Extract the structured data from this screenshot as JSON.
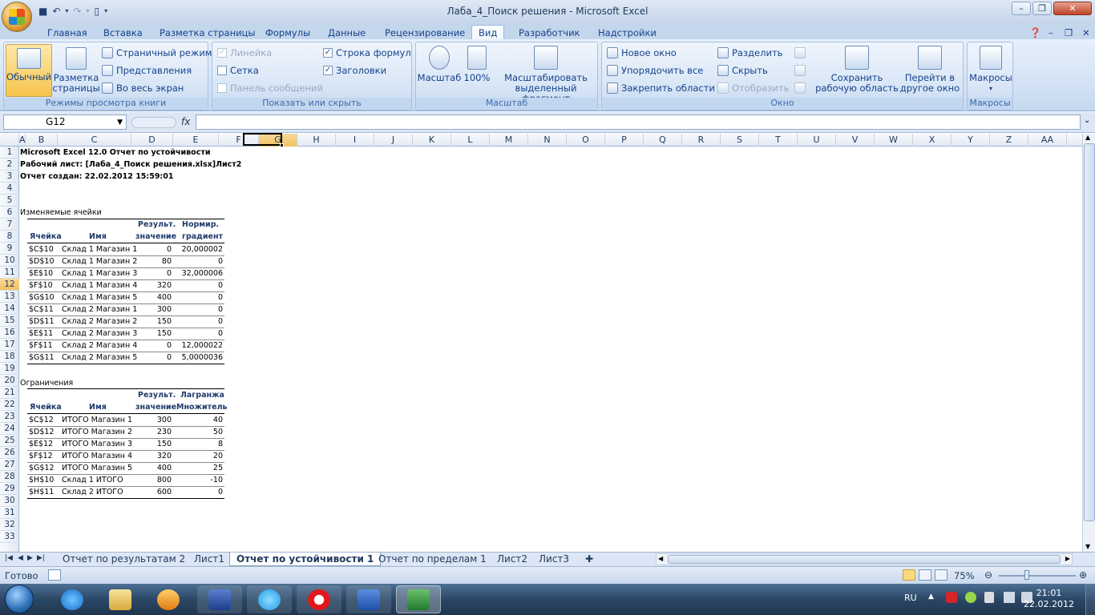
{
  "window": {
    "title": "Лаба_4_Поиск решения - Microsoft Excel"
  },
  "tabs": [
    "Главная",
    "Вставка",
    "Разметка страницы",
    "Формулы",
    "Данные",
    "Рецензирование",
    "Вид",
    "Разработчик",
    "Надстройки"
  ],
  "ribbon": {
    "normal": "Обычный",
    "page_layout": "Разметка страницы",
    "page_mode": "Страничный режим",
    "views": "Представления",
    "fullscreen": "Во весь экран",
    "group_views": "Режимы просмотра книги",
    "ruler": "Линейка",
    "grid": "Сетка",
    "msgbar": "Панель сообщений",
    "formula_bar": "Строка формул",
    "headings": "Заголовки",
    "group_show": "Показать или скрыть",
    "zoom": "Масштаб",
    "zoom100": "100%",
    "zoom_sel": "Масштабировать выделенный фрагмент",
    "group_zoom": "Масштаб",
    "new_window": "Новое окно",
    "arrange": "Упорядочить все",
    "freeze": "Закрепить области",
    "split": "Разделить",
    "hide": "Скрыть",
    "unhide": "Отобразить",
    "save_ws": "Сохранить рабочую область",
    "switch": "Перейти в другое окно",
    "group_window": "Окно",
    "macros": "Макросы",
    "group_macros": "Макросы"
  },
  "formula_bar": {
    "name_box": "G12",
    "fx": "fx",
    "formula": ""
  },
  "columns": [
    "A",
    "B",
    "C",
    "D",
    "E",
    "F",
    "G",
    "H",
    "I",
    "J",
    "K",
    "L",
    "M",
    "N",
    "O",
    "P",
    "Q",
    "R",
    "S",
    "T",
    "U",
    "V",
    "W",
    "X",
    "Y",
    "Z",
    "AA"
  ],
  "rows": [
    "1",
    "2",
    "3",
    "4",
    "5",
    "6",
    "7",
    "8",
    "9",
    "10",
    "11",
    "12",
    "13",
    "14",
    "15",
    "16",
    "17",
    "18",
    "19",
    "20",
    "21",
    "22",
    "23",
    "24",
    "25",
    "26",
    "27",
    "28",
    "29",
    "30",
    "31",
    "32",
    "33"
  ],
  "report": {
    "line1": "Microsoft Excel 12.0 Отчет по устойчивости",
    "line2": "Рабочий лист: [Лаба_4_Поиск решения.xlsx]Лист2",
    "line3": "Отчет создан: 22.02.2012 15:59:01",
    "sec1": "Изменяемые ячейки",
    "h_res1": "Результ.",
    "h_res2": "значение",
    "h_norm1": "Нормир.",
    "h_norm2": "градиент",
    "h_cell": "Ячейка",
    "h_name": "Имя",
    "sec2": "Ограничения",
    "h_lag1": "Лагранжа",
    "h_lag2": "Множитель",
    "changing": [
      [
        "$C$10",
        "Склад 1 Магазин 1",
        "0",
        "20,000002"
      ],
      [
        "$D$10",
        "Склад 1 Магазин 2",
        "80",
        "0"
      ],
      [
        "$E$10",
        "Склад 1 Магазин 3",
        "0",
        "32,000006"
      ],
      [
        "$F$10",
        "Склад 1 Магазин 4",
        "320",
        "0"
      ],
      [
        "$G$10",
        "Склад 1 Магазин 5",
        "400",
        "0"
      ],
      [
        "$C$11",
        "Склад 2 Магазин 1",
        "300",
        "0"
      ],
      [
        "$D$11",
        "Склад 2 Магазин 2",
        "150",
        "0"
      ],
      [
        "$E$11",
        "Склад 2 Магазин 3",
        "150",
        "0"
      ],
      [
        "$F$11",
        "Склад 2 Магазин 4",
        "0",
        "12,000022"
      ],
      [
        "$G$11",
        "Склад 2 Магазин 5",
        "0",
        "5,0000036"
      ]
    ],
    "constraints": [
      [
        "$C$12",
        "ИТОГО Магазин 1",
        "300",
        "40"
      ],
      [
        "$D$12",
        "ИТОГО Магазин 2",
        "230",
        "50"
      ],
      [
        "$E$12",
        "ИТОГО Магазин 3",
        "150",
        "8"
      ],
      [
        "$F$12",
        "ИТОГО Магазин 4",
        "320",
        "20"
      ],
      [
        "$G$12",
        "ИТОГО Магазин 5",
        "400",
        "25"
      ],
      [
        "$H$10",
        "Склад 1 ИТОГО",
        "800",
        "-10"
      ],
      [
        "$H$11",
        "Склад 2 ИТОГО",
        "600",
        "0"
      ]
    ]
  },
  "sheet_tabs": [
    "Отчет по результатам 2",
    "Лист1",
    "Отчет по устойчивости 1",
    "Отчет по пределам 1",
    "Лист2",
    "Лист3"
  ],
  "status": {
    "ready": "Готово",
    "zoom": "75%"
  },
  "taskbar": {
    "lang": "RU",
    "time": "21:01",
    "date": "22.02.2012"
  }
}
